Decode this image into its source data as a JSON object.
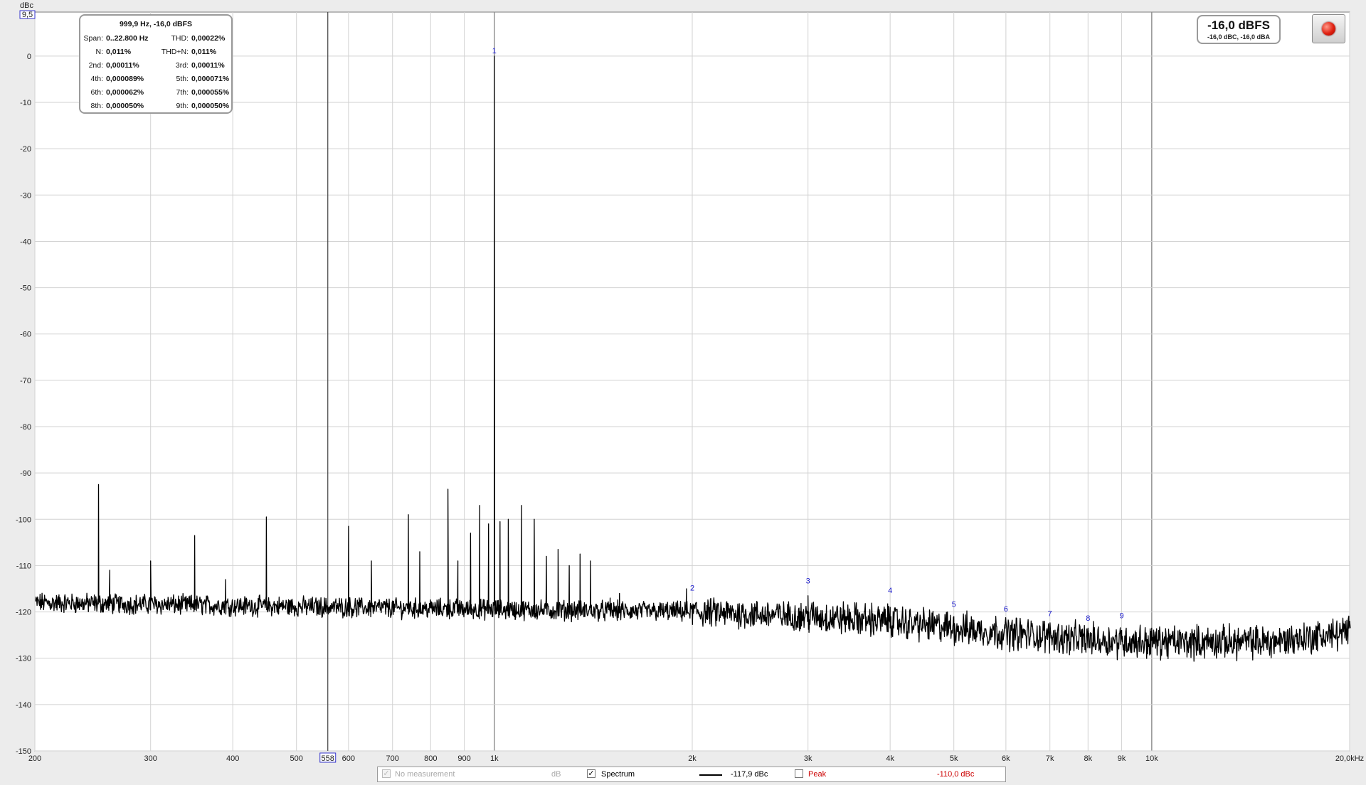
{
  "chart_data": {
    "type": "line",
    "xscale": "log",
    "xlim": [
      200,
      20000
    ],
    "ylim": [
      -150,
      9.5
    ],
    "ylabel": "dBc",
    "ytop_label": "9,5",
    "yticks": [
      {
        "v": 0,
        "label": "0"
      },
      {
        "v": -10,
        "label": "-10"
      },
      {
        "v": -20,
        "label": "-20"
      },
      {
        "v": -30,
        "label": "-30"
      },
      {
        "v": -40,
        "label": "-40"
      },
      {
        "v": -50,
        "label": "-50"
      },
      {
        "v": -60,
        "label": "-60"
      },
      {
        "v": -70,
        "label": "-70"
      },
      {
        "v": -80,
        "label": "-80"
      },
      {
        "v": -90,
        "label": "-90"
      },
      {
        "v": -100,
        "label": "-100"
      },
      {
        "v": -110,
        "label": "-110"
      },
      {
        "v": -120,
        "label": "-120"
      },
      {
        "v": -130,
        "label": "-130"
      },
      {
        "v": -140,
        "label": "-140"
      },
      {
        "v": -150,
        "label": "-150"
      }
    ],
    "xticks": [
      {
        "v": 200,
        "label": "200"
      },
      {
        "v": 300,
        "label": "300"
      },
      {
        "v": 400,
        "label": "400"
      },
      {
        "v": 500,
        "label": "500"
      },
      {
        "v": 600,
        "label": "600"
      },
      {
        "v": 700,
        "label": "700"
      },
      {
        "v": 800,
        "label": "800"
      },
      {
        "v": 900,
        "label": "900"
      },
      {
        "v": 1000,
        "label": "1k"
      },
      {
        "v": 2000,
        "label": "2k"
      },
      {
        "v": 3000,
        "label": "3k"
      },
      {
        "v": 4000,
        "label": "4k"
      },
      {
        "v": 5000,
        "label": "5k"
      },
      {
        "v": 6000,
        "label": "6k"
      },
      {
        "v": 7000,
        "label": "7k"
      },
      {
        "v": 8000,
        "label": "8k"
      },
      {
        "v": 9000,
        "label": "9k"
      },
      {
        "v": 10000,
        "label": "10k"
      },
      {
        "v": 20000,
        "label": "20,0kHz"
      }
    ],
    "cursor": {
      "x": 558,
      "label": "558"
    },
    "series": [
      {
        "name": "Spectrum",
        "color": "#000000",
        "noise_floor": [
          [
            200,
            -118
          ],
          [
            1000,
            -119.5
          ],
          [
            2000,
            -120
          ],
          [
            3000,
            -121
          ],
          [
            4000,
            -122
          ],
          [
            5000,
            -123.5
          ],
          [
            6000,
            -124.5
          ],
          [
            8000,
            -126
          ],
          [
            10000,
            -126.5
          ],
          [
            15000,
            -126.5
          ],
          [
            20000,
            -124.5
          ]
        ],
        "peaks": [
          [
            1000,
            0
          ],
          [
            250,
            -92.5
          ],
          [
            260,
            -111
          ],
          [
            300,
            -109
          ],
          [
            350,
            -103.5
          ],
          [
            390,
            -113
          ],
          [
            450,
            -99.5
          ],
          [
            600,
            -101.5
          ],
          [
            650,
            -109
          ],
          [
            740,
            -99
          ],
          [
            770,
            -107
          ],
          [
            850,
            -93.5
          ],
          [
            880,
            -109
          ],
          [
            920,
            -103
          ],
          [
            950,
            -97
          ],
          [
            980,
            -101
          ],
          [
            1020,
            -100.5
          ],
          [
            1050,
            -100
          ],
          [
            1100,
            -97
          ],
          [
            1150,
            -100
          ],
          [
            1200,
            -108
          ],
          [
            1250,
            -106.5
          ],
          [
            1300,
            -110
          ],
          [
            1350,
            -107.5
          ],
          [
            1400,
            -109
          ],
          [
            1500,
            -117
          ],
          [
            1550,
            -116
          ],
          [
            1960,
            -115
          ],
          [
            3000,
            -116.5
          ],
          [
            4000,
            -119
          ],
          [
            5000,
            -121
          ],
          [
            6000,
            -122
          ],
          [
            7000,
            -123
          ],
          [
            8000,
            -123.5
          ],
          [
            9000,
            -124
          ],
          [
            10000,
            -123.5
          ],
          [
            15000,
            -124.5
          ],
          [
            20000,
            -122
          ]
        ]
      }
    ],
    "harmonics": [
      {
        "label": "1",
        "f": 1000,
        "db": 0
      },
      {
        "label": "2",
        "f": 2000,
        "db": -116
      },
      {
        "label": "3",
        "f": 3000,
        "db": -114.5
      },
      {
        "label": "4",
        "f": 4000,
        "db": -116.5
      },
      {
        "label": "5",
        "f": 5000,
        "db": -119.5
      },
      {
        "label": "6",
        "f": 6000,
        "db": -120.5
      },
      {
        "label": "7",
        "f": 7000,
        "db": -121.5
      },
      {
        "label": "8",
        "f": 8000,
        "db": -122.5
      },
      {
        "label": "9",
        "f": 9000,
        "db": -122
      }
    ]
  },
  "info": {
    "header": "999,9 Hz, -16,0 dBFS",
    "span_label": "Span:",
    "span_value": "0..22.800 Hz",
    "thd_label": "THD:",
    "thd_value": "0,00022%",
    "n_label": "N:",
    "n_value": "0,011%",
    "thdn_label": "THD+N:",
    "thdn_value": "0,011%",
    "h2_label": "2nd:",
    "h2_value": "0,00011%",
    "h3_label": "3rd:",
    "h3_value": "0,00011%",
    "h4_label": "4th:",
    "h4_value": "0,000089%",
    "h5_label": "5th:",
    "h5_value": "0,000071%",
    "h6_label": "6th:",
    "h6_value": "0,000062%",
    "h7_label": "7th:",
    "h7_value": "0,000055%",
    "h8_label": "8th:",
    "h8_value": "0,000050%",
    "h9_label": "9th:",
    "h9_value": "0,000050%"
  },
  "level": {
    "main": "-16,0 dBFS",
    "sub": "-16,0 dBC, -16,0 dBA"
  },
  "legend": {
    "no_measurement": "No measurement",
    "db_unit": "dB",
    "spectrum_label": "Spectrum",
    "spectrum_value": "-117,9 dBc",
    "peak_label": "Peak",
    "peak_value": "-110,0 dBc",
    "peak_color": "#cc0000"
  }
}
